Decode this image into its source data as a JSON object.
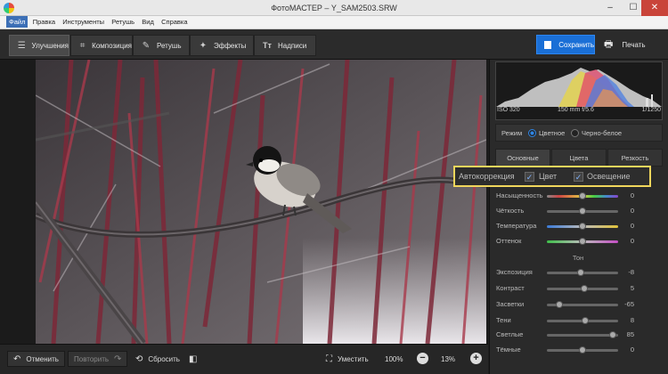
{
  "window": {
    "title": "ФотоМАСТЕР – Y_SAM2503.SRW",
    "minimize": "–",
    "maximize": "☐",
    "close": "✕"
  },
  "menu": [
    "Файл",
    "Правка",
    "Инструменты",
    "Ретушь",
    "Вид",
    "Справка"
  ],
  "tabs": [
    {
      "label": "Улучшения",
      "icon": "sliders-icon",
      "glyph": "☰"
    },
    {
      "label": "Композиция",
      "icon": "crop-icon",
      "glyph": "⌗"
    },
    {
      "label": "Ретушь",
      "icon": "brush-icon",
      "glyph": "✎"
    },
    {
      "label": "Эффекты",
      "icon": "magic-wand-icon",
      "glyph": "✦"
    },
    {
      "label": "Надписи",
      "icon": "text-icon",
      "glyph": "Tт"
    }
  ],
  "actions": {
    "save": "Сохранить",
    "print": "Печать"
  },
  "bottom": {
    "undo": "Отменить",
    "redo": "Повторить",
    "reset": "Сбросить",
    "fit": "Уместить",
    "zoom100": "100%",
    "zoom_current": "13%",
    "zoom_out": "−",
    "zoom_in": "+"
  },
  "histogram": {
    "iso": "ISO 320",
    "lens": "150 mm f/5.6",
    "shutter": "1/1250"
  },
  "mode": {
    "label": "Режим",
    "color": "Цветное",
    "bw": "Черно-белое",
    "selected": "color"
  },
  "subtabs": [
    "Основные",
    "Цвета",
    "Резкость"
  ],
  "autocorrection": {
    "label": "Автокоррекция",
    "color": "Цвет",
    "light": "Освещение",
    "color_checked": true,
    "light_checked": true
  },
  "sliders_color": [
    {
      "label": "Насыщенность",
      "value": "0",
      "position": 0.5
    },
    {
      "label": "Чёткость",
      "value": "0",
      "position": 0.5
    },
    {
      "label": "Температура",
      "value": "0",
      "position": 0.5
    },
    {
      "label": "Оттенок",
      "value": "0",
      "position": 0.5
    }
  ],
  "tone_label": "Тон",
  "sliders_tone": [
    {
      "label": "Экспозиция",
      "value": "-8",
      "position": 0.47
    },
    {
      "label": "Контраст",
      "value": "5",
      "position": 0.52
    },
    {
      "label": "Засветки",
      "value": "-65",
      "position": 0.18
    },
    {
      "label": "Тени",
      "value": "8",
      "position": 0.54
    },
    {
      "label": "Светлые",
      "value": "85",
      "position": 0.93
    },
    {
      "label": "Тёмные",
      "value": "0",
      "position": 0.5
    }
  ],
  "colors": {
    "accent": "#1a6fd6",
    "highlight": "#f0d65c"
  }
}
